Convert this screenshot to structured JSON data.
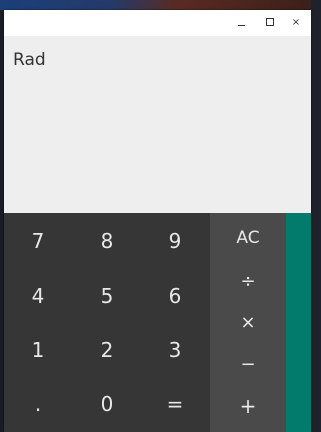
{
  "window": {
    "controls": {
      "minimize_icon": "minimize-icon",
      "maximize_icon": "maximize-icon",
      "close_icon": "close-icon",
      "close_glyph": "×"
    }
  },
  "display": {
    "angle_mode": "Rad"
  },
  "keypad": {
    "digits": [
      [
        "7",
        "8",
        "9"
      ],
      [
        "4",
        "5",
        "6"
      ],
      [
        "1",
        "2",
        "3"
      ],
      [
        ".",
        "0",
        "="
      ]
    ],
    "operators": [
      "AC",
      "÷",
      "×",
      "−",
      "+"
    ]
  },
  "colors": {
    "display_bg": "#eeeeee",
    "numpad_bg": "#363636",
    "operator_bg": "#4a4a4a",
    "advanced_bg": "#027b6d"
  }
}
